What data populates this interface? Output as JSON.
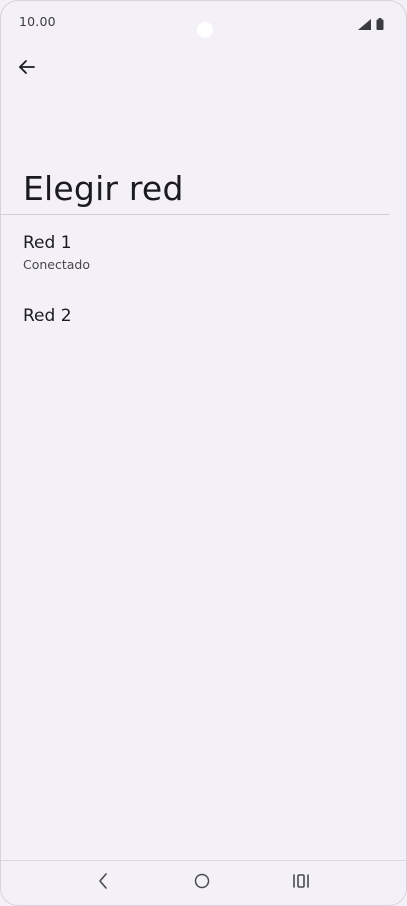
{
  "status_bar": {
    "time": "10.00",
    "icons": [
      "cell-signal-icon",
      "battery-icon"
    ]
  },
  "app_bar": {
    "back_icon": "arrow-left-icon"
  },
  "page": {
    "title": "Elegir red"
  },
  "networks": [
    {
      "name": "Red 1",
      "status": "Conectado"
    },
    {
      "name": "Red 2",
      "status": ""
    }
  ],
  "nav_bar": {
    "icons": [
      "nav-back-icon",
      "nav-home-icon",
      "nav-recents-icon"
    ]
  },
  "colors": {
    "background": "#f4f0f8",
    "text_primary": "#1b1b1f",
    "text_secondary": "#47464f",
    "divider": "#d3cfd8"
  }
}
